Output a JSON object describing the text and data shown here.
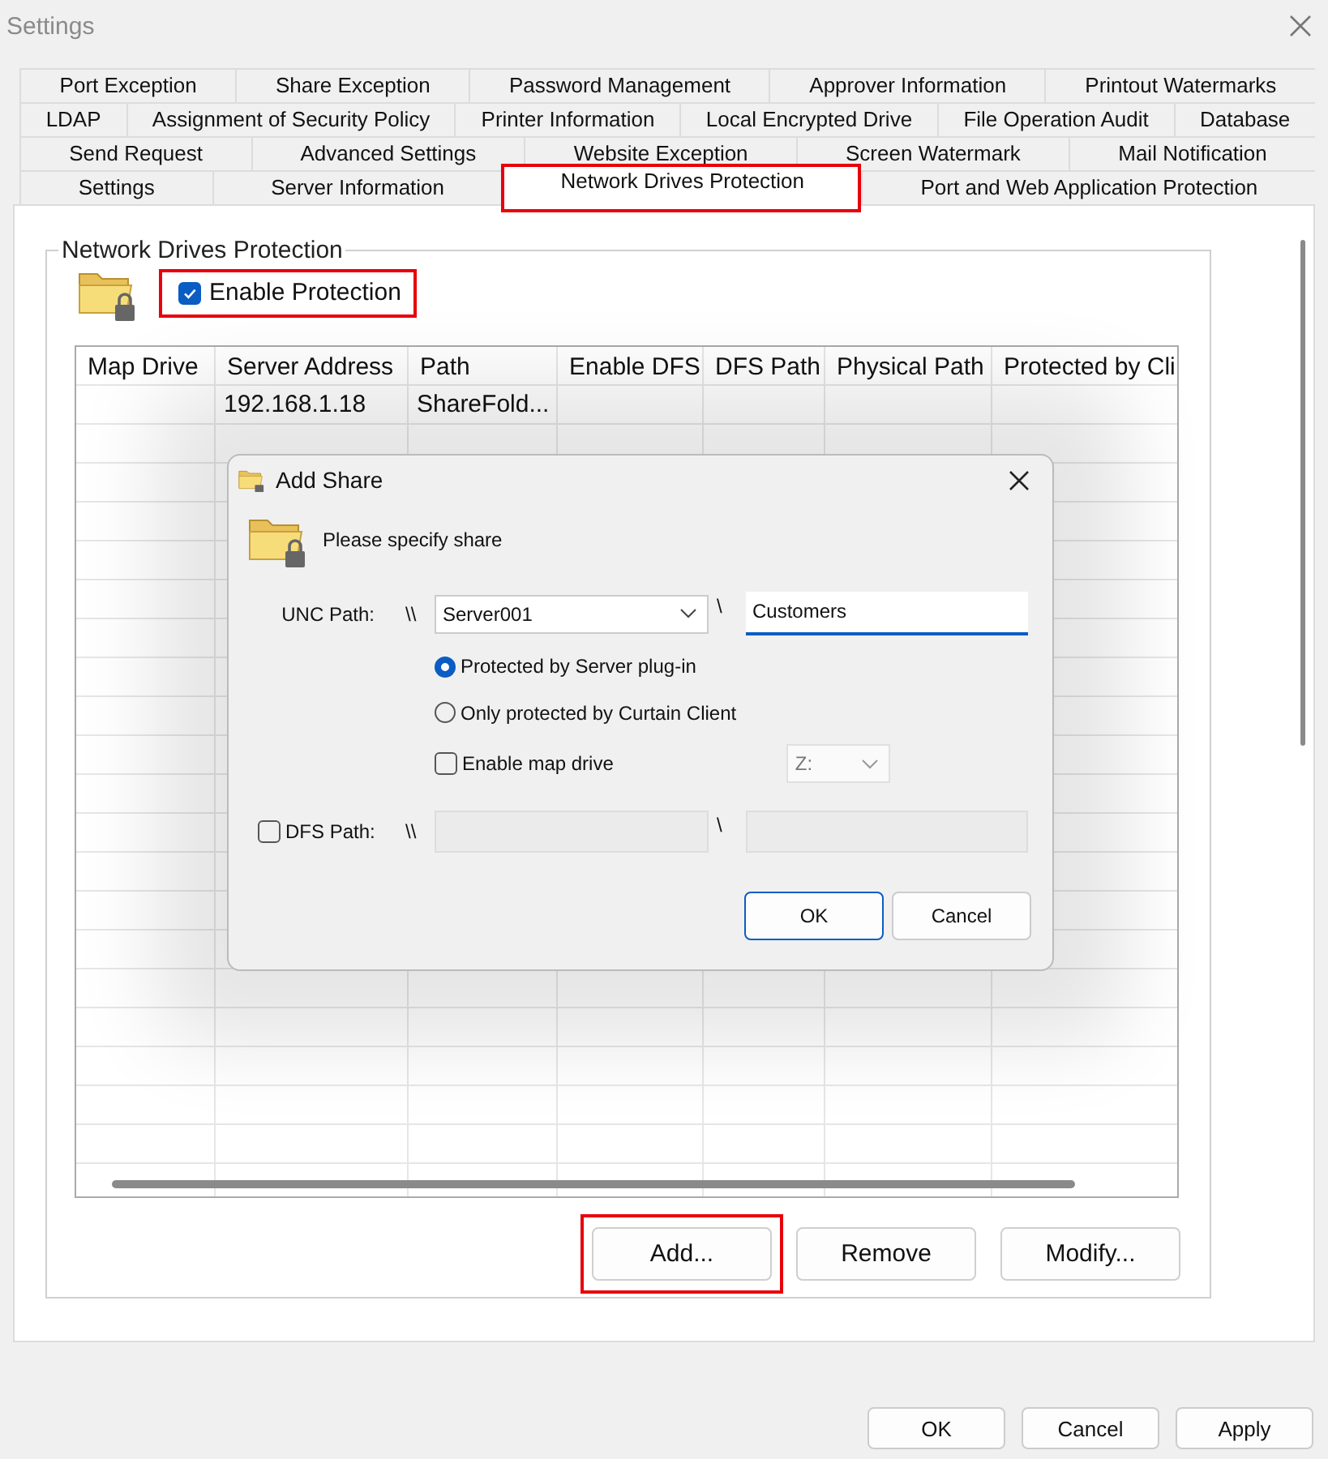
{
  "window": {
    "title": "Settings"
  },
  "tab_rows": [
    [
      {
        "label": "Port Exception",
        "selected": false,
        "highlighted": false
      },
      {
        "label": "Share Exception",
        "selected": false,
        "highlighted": false
      },
      {
        "label": "Password Management",
        "selected": false,
        "highlighted": false
      },
      {
        "label": "Approver Information",
        "selected": false,
        "highlighted": false
      },
      {
        "label": "Printout Watermarks",
        "selected": false,
        "highlighted": false
      }
    ],
    [
      {
        "label": "LDAP",
        "selected": false,
        "highlighted": false
      },
      {
        "label": "Assignment of Security Policy",
        "selected": false,
        "highlighted": false
      },
      {
        "label": "Printer Information",
        "selected": false,
        "highlighted": false
      },
      {
        "label": "Local Encrypted Drive",
        "selected": false,
        "highlighted": false
      },
      {
        "label": "File Operation Audit",
        "selected": false,
        "highlighted": false
      },
      {
        "label": "Database",
        "selected": false,
        "highlighted": false
      }
    ],
    [
      {
        "label": "Send Request",
        "selected": false,
        "highlighted": false
      },
      {
        "label": "Advanced Settings",
        "selected": false,
        "highlighted": false
      },
      {
        "label": "Website Exception",
        "selected": false,
        "highlighted": false
      },
      {
        "label": "Screen Watermark",
        "selected": false,
        "highlighted": false
      },
      {
        "label": "Mail Notification",
        "selected": false,
        "highlighted": false
      }
    ],
    [
      {
        "label": "Settings",
        "selected": false,
        "highlighted": false
      },
      {
        "label": "Server Information",
        "selected": false,
        "highlighted": false
      },
      {
        "label": "Network Drives Protection",
        "selected": true,
        "highlighted": true
      },
      {
        "label": "Port and Web Application Protection",
        "selected": false,
        "highlighted": false
      }
    ]
  ],
  "group": {
    "title": "Network Drives Protection",
    "enable": {
      "label": "Enable Protection",
      "checked": true,
      "highlighted": true
    }
  },
  "table": {
    "columns": [
      "Map Drive",
      "Server Address",
      "Path",
      "Enable DFS",
      "DFS Path",
      "Physical Path",
      "Protected by Cli"
    ],
    "rows": [
      {
        "server_address": "192.168.1.18",
        "path": "ShareFold..."
      }
    ]
  },
  "buttons": [
    {
      "label": "Add...",
      "highlighted": true
    },
    {
      "label": "Remove",
      "highlighted": false
    },
    {
      "label": "Modify...",
      "highlighted": false
    }
  ],
  "dialog": {
    "title": "Add Share",
    "prompt": "Please specify share",
    "unc_label": "UNC Path:",
    "unc_prefix": "\\\\",
    "server": "Server001",
    "separator": "\\",
    "share": "Customers",
    "options": [
      {
        "label": "Protected by Server plug-in",
        "selected": true
      },
      {
        "label": "Only protected by Curtain Client",
        "selected": false
      }
    ],
    "map_drive": {
      "label": "Enable map drive",
      "checked": false,
      "drive": "Z:",
      "disabled": true
    },
    "dfs": {
      "label": "DFS Path:",
      "checked": false,
      "prefix": "\\\\",
      "separator": "\\",
      "disabled": true
    },
    "buttons": [
      {
        "label": "OK",
        "default": true
      },
      {
        "label": "Cancel",
        "default": false
      }
    ]
  },
  "footer_buttons": [
    "OK",
    "Cancel",
    "Apply"
  ]
}
